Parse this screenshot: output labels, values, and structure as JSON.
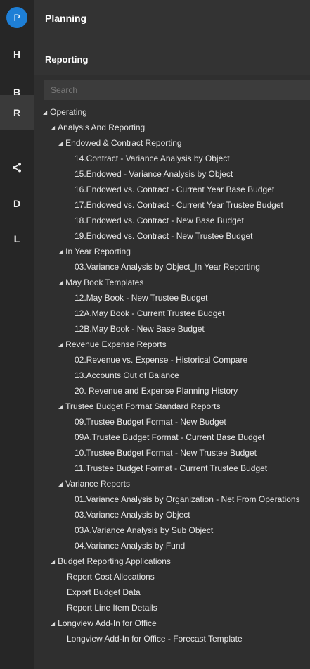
{
  "rail": {
    "avatar": "P",
    "items": [
      {
        "label": "H",
        "active": false
      },
      {
        "label": "B",
        "active": false
      },
      {
        "label": "R",
        "active": true
      },
      {
        "label": "",
        "icon": "share-icon",
        "active": false
      },
      {
        "label": "D",
        "active": false
      },
      {
        "label": "L",
        "active": false
      }
    ]
  },
  "header": {
    "title": "Planning"
  },
  "panel": {
    "title": "Reporting"
  },
  "search": {
    "placeholder": "Search"
  },
  "tree": {
    "operating": "Operating",
    "analysis": "Analysis And Reporting",
    "endowed": "Endowed & Contract Reporting",
    "endowed_items": [
      "14.Contract - Variance Analysis by Object",
      "15.Endowed - Variance Analysis by Object",
      "16.Endowed vs. Contract - Current Year Base Budget",
      "17.Endowed vs. Contract - Current Year Trustee Budget",
      "18.Endowed vs. Contract - New Base Budget",
      "19.Endowed vs. Contract - New Trustee Budget"
    ],
    "inyear": "In Year Reporting",
    "inyear_items": [
      "03.Variance Analysis by Object_In Year Reporting"
    ],
    "maybook": "May Book Templates",
    "maybook_items": [
      "12.May Book - New Trustee Budget",
      "12A.May Book - Current Trustee Budget",
      "12B.May Book - New Base Budget"
    ],
    "revenue": "Revenue Expense Reports",
    "revenue_items": [
      "02.Revenue vs. Expense - Historical Compare",
      "13.Accounts Out of Balance",
      "20. Revenue and Expense Planning History"
    ],
    "trustee": "Trustee Budget Format Standard Reports",
    "trustee_items": [
      "09.Trustee Budget Format - New Budget",
      "09A.Trustee Budget Format - Current Base Budget",
      "10.Trustee Budget Format - New Trustee Budget",
      "11.Trustee Budget Format - Current Trustee Budget"
    ],
    "variance": "Variance Reports",
    "variance_items": [
      "01.Variance Analysis by Organization - Net From Operations",
      "03.Variance Analysis by Object",
      "03A.Variance Analysis by Sub Object",
      "04.Variance Analysis by Fund"
    ],
    "budgetapps": "Budget Reporting Applications",
    "budgetapps_items": [
      "Report Cost Allocations",
      "Export Budget Data",
      "Report Line Item Details"
    ],
    "longview": "Longview Add-In for Office",
    "longview_items": [
      "Longview Add-In for Office - Forecast Template"
    ]
  }
}
